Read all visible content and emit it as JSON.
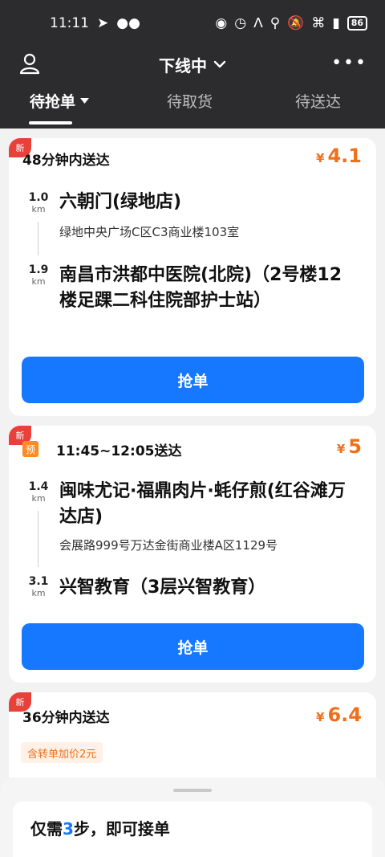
{
  "status_bar": {
    "time": "11:11",
    "battery": "86"
  },
  "header": {
    "title": "下线中"
  },
  "tabs": [
    {
      "label": "待抢单"
    },
    {
      "label": "待取货"
    },
    {
      "label": "待送达"
    }
  ],
  "orders": [
    {
      "badge": "新",
      "delivery_time": "48分钟内送达",
      "currency": "¥",
      "price": "4.1",
      "pickup_distance": "1.0",
      "pickup_unit": "km",
      "pickup_name": "六朝门(绿地店)",
      "pickup_address": "绿地中央广场C区C3商业楼103室",
      "dropoff_distance": "1.9",
      "dropoff_unit": "km",
      "dropoff_name": "南昌市洪都中医院(北院)（2号楼12楼足踝二科住院部护士站）",
      "button_label": "抢单"
    },
    {
      "badge": "新",
      "pre_tag": "预",
      "delivery_time": "11:45~12:05送达",
      "currency": "¥",
      "price": "5",
      "pickup_distance": "1.4",
      "pickup_unit": "km",
      "pickup_name": "闽味尤记·福鼎肉片·蚝仔煎(红谷滩万达店)",
      "pickup_address": "会展路999号万达金街商业楼A区1129号",
      "dropoff_distance": "3.1",
      "dropoff_unit": "km",
      "dropoff_name": "兴智教育（3层兴智教育）",
      "button_label": "抢单"
    },
    {
      "badge": "新",
      "delivery_time": "36分钟内送达",
      "currency": "¥",
      "price": "6.4",
      "tag": "含转单加价2元"
    }
  ],
  "bottom_sheet": {
    "title_prefix": "仅需",
    "title_highlight": "3",
    "title_suffix": "步，即可接单"
  }
}
